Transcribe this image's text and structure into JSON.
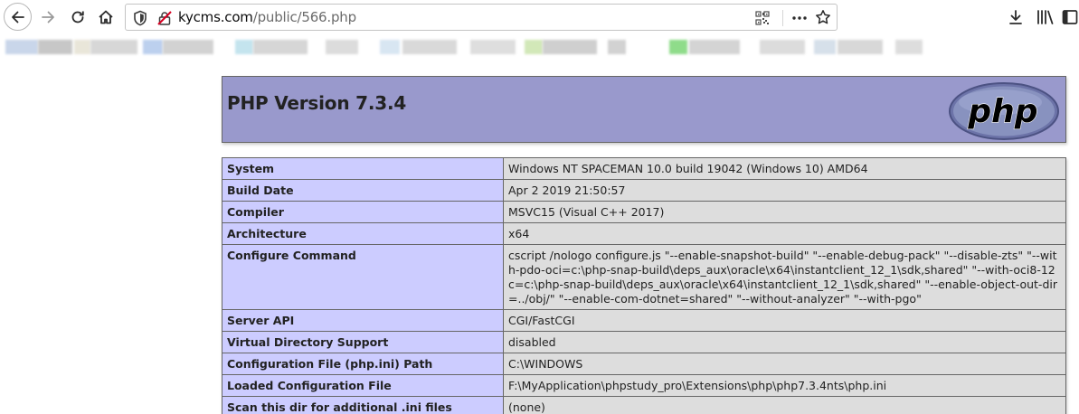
{
  "browser": {
    "url_host": "kycms.com",
    "url_path": "/public/566.php",
    "icons": [
      "back-icon",
      "forward-icon",
      "reload-icon",
      "home-icon",
      "shield-icon",
      "insecure-lock-icon",
      "qr-code-icon",
      "more-icon",
      "star-icon",
      "download-icon",
      "library-icon",
      "sidebar-icon"
    ]
  },
  "phpinfo": {
    "title": "PHP Version 7.3.4",
    "logo_text": "php",
    "colors": {
      "header_bg": "#9999cc",
      "key_bg": "#ccccff",
      "value_bg": "#dddddd",
      "border": "#666666"
    },
    "rows": [
      {
        "key": "System",
        "value": "Windows NT SPACEMAN 10.0 build 19042 (Windows 10) AMD64"
      },
      {
        "key": "Build Date",
        "value": "Apr 2 2019 21:50:57"
      },
      {
        "key": "Compiler",
        "value": "MSVC15 (Visual C++ 2017)"
      },
      {
        "key": "Architecture",
        "value": "x64"
      },
      {
        "key": "Configure Command",
        "value": "cscript /nologo configure.js \"--enable-snapshot-build\" \"--enable-debug-pack\" \"--disable-zts\" \"--with-pdo-oci=c:\\php-snap-build\\deps_aux\\oracle\\x64\\instantclient_12_1\\sdk,shared\" \"--with-oci8-12c=c:\\php-snap-build\\deps_aux\\oracle\\x64\\instantclient_12_1\\sdk,shared\" \"--enable-object-out-dir=../obj/\" \"--enable-com-dotnet=shared\" \"--without-analyzer\" \"--with-pgo\""
      },
      {
        "key": "Server API",
        "value": "CGI/FastCGI"
      },
      {
        "key": "Virtual Directory Support",
        "value": "disabled"
      },
      {
        "key": "Configuration File (php.ini) Path",
        "value": "C:\\WINDOWS"
      },
      {
        "key": "Loaded Configuration File",
        "value": "F:\\MyApplication\\phpstudy_pro\\Extensions\\php\\php7.3.4nts\\php.ini"
      },
      {
        "key": "Scan this dir for additional .ini files",
        "value": "(none)"
      }
    ]
  }
}
